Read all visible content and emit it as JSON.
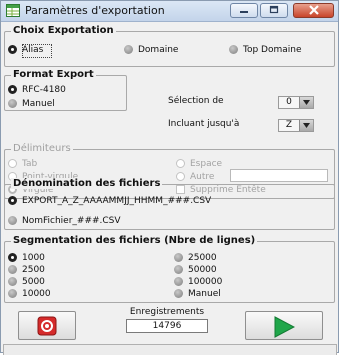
{
  "window": {
    "title": "Paramètres d'exportation",
    "icon": "spreadsheet-export-icon"
  },
  "choix": {
    "legend": "Choix Exportation",
    "options": [
      "Alias",
      "Domaine",
      "Top Domaine"
    ],
    "selected": "Alias"
  },
  "format": {
    "legend": "Format Export",
    "options": [
      "RFC-4180",
      "Manuel"
    ],
    "selected": "RFC-4180",
    "selection_label": "Sélection de",
    "selection_value": "0",
    "incluant_label": "Incluant jusqu'à",
    "incluant_value": "Z"
  },
  "delim": {
    "legend": "Délimiteurs",
    "tab": "Tab",
    "point_virgule": "Point-virgule",
    "virgule": "Virgule",
    "espace": "Espace",
    "autre": "Autre",
    "autre_value": "",
    "supprime": "Supprime Entête",
    "selected": "Virgule",
    "enabled": false
  },
  "denom": {
    "legend": "Dénomination des fichiers",
    "option1": "EXPORT_A_Z_AAAAMMJJ_HHMM_###.CSV",
    "option2": "NomFichier_###.CSV",
    "selected": "option1"
  },
  "seg": {
    "legend": "Segmentation des fichiers (Nbre de lignes)",
    "left": [
      "1000",
      "2500",
      "5000",
      "10000"
    ],
    "right": [
      "25000",
      "50000",
      "100000",
      "Manuel"
    ],
    "selected": "1000"
  },
  "footer": {
    "counter_label": "Enregistrements",
    "counter_value": "14796",
    "stop_icon": "stop-power-icon",
    "play_icon": "play-icon"
  },
  "colors": {
    "stop_red": "#d52b2b",
    "play_green": "#1fa64a",
    "close_red": "#c8442a"
  }
}
